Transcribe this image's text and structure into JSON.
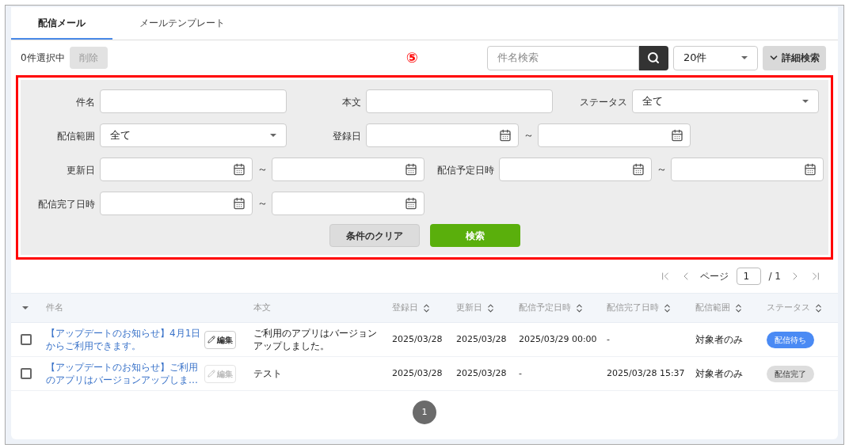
{
  "tabs": [
    {
      "label": "配信メール",
      "selected": true
    },
    {
      "label": "メールテンプレート",
      "selected": false
    }
  ],
  "toolbar": {
    "selection_count": "0件選択中",
    "delete_button": {
      "label": "削除",
      "disabled": true
    },
    "marker": "⑤",
    "search": {
      "placeholder": "件名検索"
    },
    "per_page": "20件",
    "advanced_button": "詳細検索"
  },
  "filters": {
    "rows": [
      [
        {
          "label": "件名",
          "kind": "text"
        },
        {
          "label": "本文",
          "kind": "text"
        },
        {
          "label": "ステータス",
          "kind": "select",
          "value": "全て"
        }
      ],
      [
        {
          "label": "配信範囲",
          "kind": "select",
          "value": "全て"
        },
        {
          "label": "登録日",
          "kind": "range",
          "separator": "～"
        }
      ],
      [
        {
          "label": "更新日",
          "kind": "range",
          "separator": "～"
        },
        {
          "label": "配信予定日時",
          "kind": "range",
          "separator": "～"
        }
      ],
      [
        {
          "label": "配信完了日時",
          "kind": "range",
          "separator": "～"
        }
      ]
    ],
    "clear_button": "条件のクリア",
    "search_button": "検索"
  },
  "pager": {
    "page_label": "ページ",
    "page": "1",
    "total": "/ 1"
  },
  "table": {
    "columns": [
      {
        "label": "件名",
        "sortable": false
      },
      {
        "label": "本文",
        "sortable": false
      },
      {
        "label": "登録日",
        "sortable": true
      },
      {
        "label": "更新日",
        "sortable": true
      },
      {
        "label": "配信予定日時",
        "sortable": true
      },
      {
        "label": "配信完了日時",
        "sortable": true
      },
      {
        "label": "配信範囲",
        "sortable": true
      },
      {
        "label": "ステータス",
        "sortable": true
      }
    ],
    "rows": [
      {
        "checked": false,
        "subject": "【アップデートのお知らせ】4月1日からご利用できます。",
        "edit": {
          "label": "編集",
          "disabled": false
        },
        "body": "ご利用のアプリはバージョンアップしました。",
        "created": "2025/03/28",
        "updated": "2025/03/28",
        "scheduled": "2025/03/29 00:00",
        "completed": "-",
        "scope": "対象者のみ",
        "status": {
          "label": "配信待ち",
          "kind": "waiting"
        }
      },
      {
        "checked": false,
        "subject": "【アップデートのお知らせ】ご利用のアプリはバージョンアップしま…",
        "edit": {
          "label": "編集",
          "disabled": true
        },
        "body": "テスト",
        "created": "2025/03/28",
        "updated": "2025/03/28",
        "scheduled": "-",
        "completed": "2025/03/28 15:37",
        "scope": "対象者のみ",
        "status": {
          "label": "配信完了",
          "kind": "done"
        }
      }
    ]
  },
  "pagination": [
    {
      "label": "1",
      "selected": true
    }
  ]
}
